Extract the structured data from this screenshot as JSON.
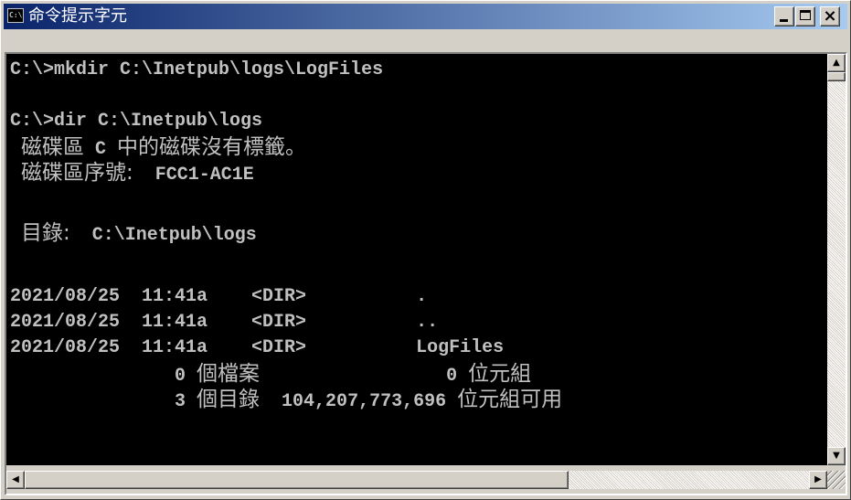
{
  "window": {
    "title": "命令提示字元",
    "icon": "console-icon",
    "icon_text": "C:\\"
  },
  "caption_buttons": {
    "minimize_icon": "minimize-icon",
    "maximize_icon": "maximize-icon",
    "close_icon": "close-icon",
    "close_glyph": "×"
  },
  "console": {
    "background": "#000000",
    "foreground": "#c0c0c0",
    "lines": [
      {
        "parts": [
          {
            "t": "C:\\>mkdir C:\\Inetpub\\logs\\LogFiles",
            "cjk": false
          }
        ]
      },
      {
        "parts": [
          {
            "t": "",
            "cjk": false
          }
        ]
      },
      {
        "parts": [
          {
            "t": "C:\\>dir C:\\Inetpub\\logs",
            "cjk": false
          }
        ]
      },
      {
        "parts": [
          {
            "t": " ",
            "cjk": false
          },
          {
            "t": "磁碟區",
            "cjk": true
          },
          {
            "t": " C ",
            "cjk": false
          },
          {
            "t": "中的磁碟沒有標籤。",
            "cjk": true
          }
        ]
      },
      {
        "parts": [
          {
            "t": " ",
            "cjk": false
          },
          {
            "t": "磁碟區序號:",
            "cjk": true
          },
          {
            "t": "  FCC1-AC1E",
            "cjk": false
          }
        ]
      },
      {
        "parts": [
          {
            "t": "",
            "cjk": false
          }
        ]
      },
      {
        "parts": [
          {
            "t": " ",
            "cjk": false
          },
          {
            "t": "目錄:",
            "cjk": true
          },
          {
            "t": "  C:\\Inetpub\\logs",
            "cjk": false
          }
        ]
      },
      {
        "parts": [
          {
            "t": "",
            "cjk": false
          }
        ]
      },
      {
        "parts": [
          {
            "t": "2021/08/25  11:41a    <DIR>          .",
            "cjk": false
          }
        ]
      },
      {
        "parts": [
          {
            "t": "2021/08/25  11:41a    <DIR>          ..",
            "cjk": false
          }
        ]
      },
      {
        "parts": [
          {
            "t": "2021/08/25  11:41a    <DIR>          LogFiles",
            "cjk": false
          }
        ]
      },
      {
        "parts": [
          {
            "t": "               0 ",
            "cjk": false
          },
          {
            "t": "個檔案",
            "cjk": true
          },
          {
            "t": "                 0 ",
            "cjk": false
          },
          {
            "t": "位元組",
            "cjk": true
          }
        ]
      },
      {
        "parts": [
          {
            "t": "               3 ",
            "cjk": false
          },
          {
            "t": "個目錄",
            "cjk": true
          },
          {
            "t": "  104,207,773,696 ",
            "cjk": false
          },
          {
            "t": "位元組可用",
            "cjk": true
          }
        ]
      }
    ]
  },
  "scrollbars": {
    "up_arrow": "▲",
    "down_arrow": "▼",
    "left_arrow": "◀",
    "right_arrow": "▶",
    "vertical_position": 0.0,
    "horizontal_position": 0.0
  }
}
